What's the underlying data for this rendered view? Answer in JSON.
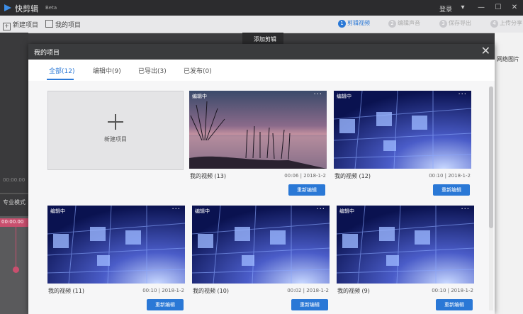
{
  "app": {
    "title": "快剪辑",
    "beta": "Beta",
    "login": "登录"
  },
  "toolbar": {
    "new_project": "新建项目",
    "my_projects": "我的项目",
    "steps": [
      {
        "num": "1",
        "label": "剪辑视频"
      },
      {
        "num": "2",
        "label": "编辑声音"
      },
      {
        "num": "3",
        "label": "保存导出"
      },
      {
        "num": "4",
        "label": "上传分享"
      }
    ]
  },
  "background": {
    "time": "00:00.00",
    "mode": "专业模式",
    "pink_time": "00:00.00",
    "add_clip": "添加剪辑",
    "right_text": "网络图片"
  },
  "modal": {
    "title": "我的项目",
    "tabs": [
      "全部(12)",
      "编辑中(9)",
      "已导出(3)",
      "已发布(0)"
    ],
    "new_project_label": "新建项目",
    "reedit_label": "重新编辑",
    "cards": [
      {
        "badge": "编辑中",
        "name": "我的视频 (13)",
        "duration": "00:06",
        "date": "2018-1-2",
        "thumb": "sunset"
      },
      {
        "badge": "编辑中",
        "name": "我的视频 (12)",
        "duration": "00:10",
        "date": "2018-1-2",
        "thumb": "blue"
      },
      {
        "badge": "编辑中",
        "name": "我的视频 (11)",
        "duration": "00:10",
        "date": "2018-1-2",
        "thumb": "blue"
      },
      {
        "badge": "编辑中",
        "name": "我的视频 (10)",
        "duration": "00:02",
        "date": "2018-1-2",
        "thumb": "blue"
      },
      {
        "badge": "编辑中",
        "name": "我的视频 (9)",
        "duration": "00:10",
        "date": "2018-1-2",
        "thumb": "blue"
      }
    ]
  }
}
